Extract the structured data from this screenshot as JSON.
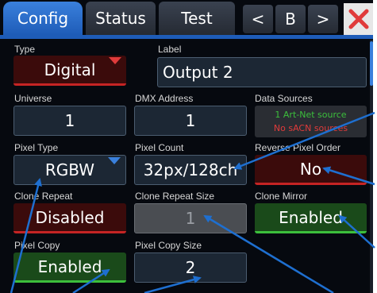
{
  "tabs": [
    {
      "label": "Config"
    },
    {
      "label": "Status"
    },
    {
      "label": "Test"
    }
  ],
  "nav": {
    "prev": "<",
    "page": "B",
    "next": ">"
  },
  "colors": {
    "close": "#e03b3b",
    "accent": "#1e5cb8",
    "callout": "#1e6fd0"
  },
  "fields": {
    "type": {
      "label": "Type",
      "value": "Digital"
    },
    "output_label": {
      "label": "Label",
      "value": "Output 2"
    },
    "universe": {
      "label": "Universe",
      "value": "1"
    },
    "dmx_address": {
      "label": "DMX Address",
      "value": "1"
    },
    "data_sources": {
      "label": "Data Sources",
      "line1": "1 Art-Net source",
      "line2": "No sACN sources"
    },
    "pixel_type": {
      "label": "Pixel Type",
      "value": "RGBW"
    },
    "pixel_count": {
      "label": "Pixel Count",
      "value": "32px/128ch"
    },
    "reverse_pixel_order": {
      "label": "Reverse Pixel Order",
      "value": "No"
    },
    "clone_repeat": {
      "label": "Clone Repeat",
      "value": "Disabled"
    },
    "clone_repeat_size": {
      "label": "Clone Repeat Size",
      "value": "1"
    },
    "clone_mirror": {
      "label": "Clone Mirror",
      "value": "Enabled"
    },
    "pixel_copy": {
      "label": "Pixel Copy",
      "value": "Enabled"
    },
    "pixel_copy_size": {
      "label": "Pixel Copy Size",
      "value": "2"
    }
  }
}
